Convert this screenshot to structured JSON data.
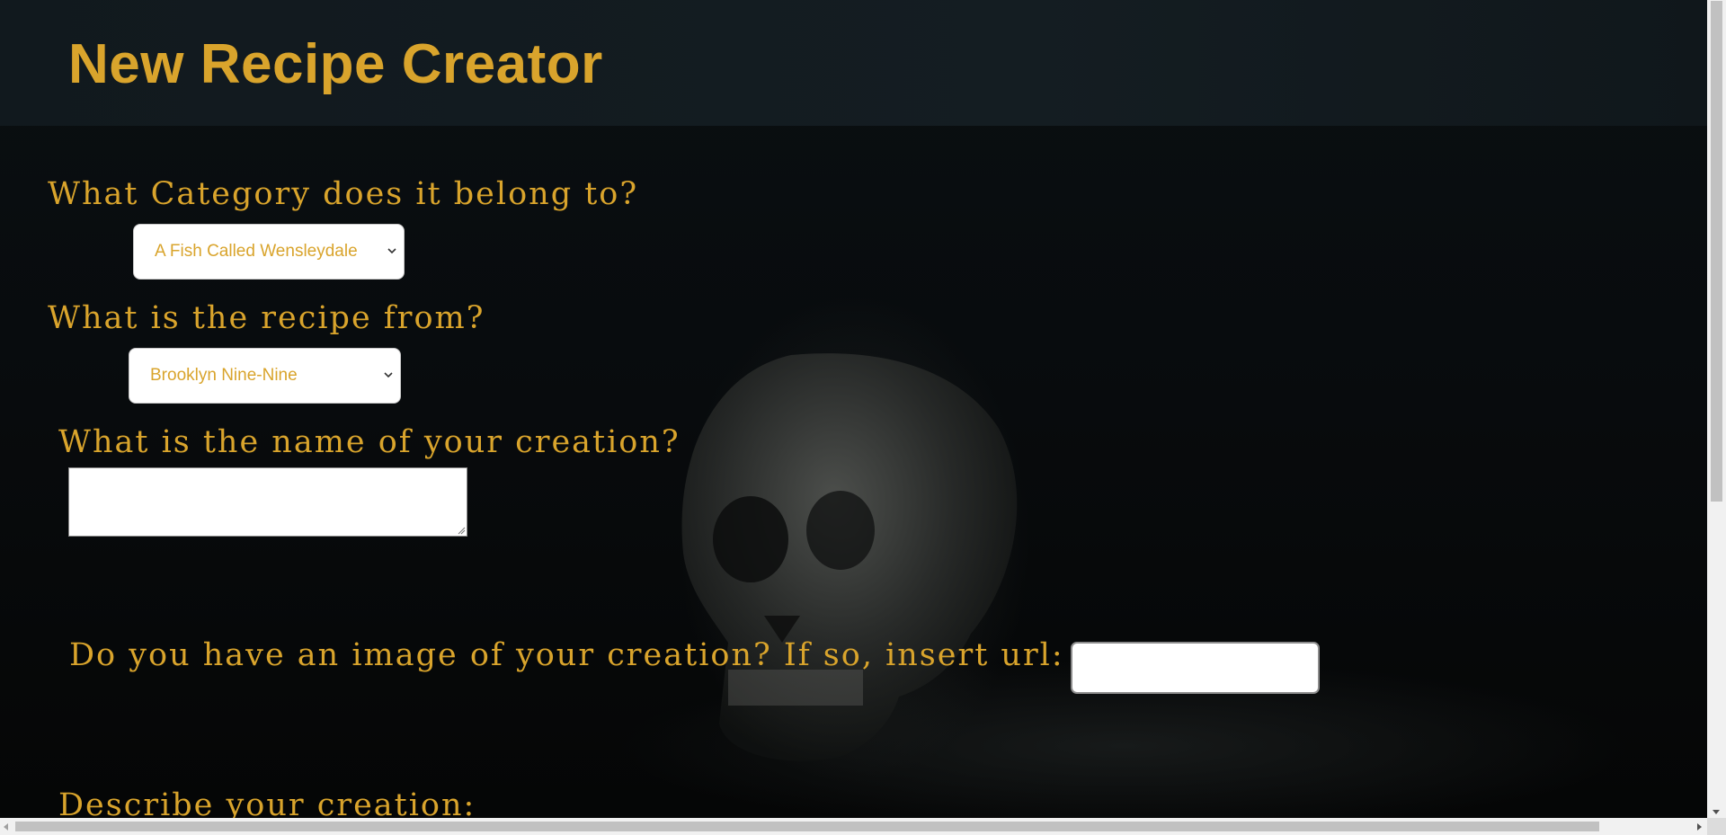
{
  "header": {
    "title": "New Recipe Creator"
  },
  "form": {
    "category": {
      "label": "What Category does it belong to?",
      "selected": "A Fish Called Wensleydale"
    },
    "source": {
      "label": "What is the recipe from?",
      "selected": "Brooklyn Nine-Nine"
    },
    "name": {
      "label": "What is the name of your creation?",
      "value": ""
    },
    "image": {
      "label": "Do you have an image of your creation? If so, insert url:",
      "value": ""
    },
    "description": {
      "label": "Describe your creation:"
    }
  },
  "colors": {
    "accent": "#d9a42c",
    "header_bg": "#141d22",
    "page_bg": "#080b0d"
  }
}
